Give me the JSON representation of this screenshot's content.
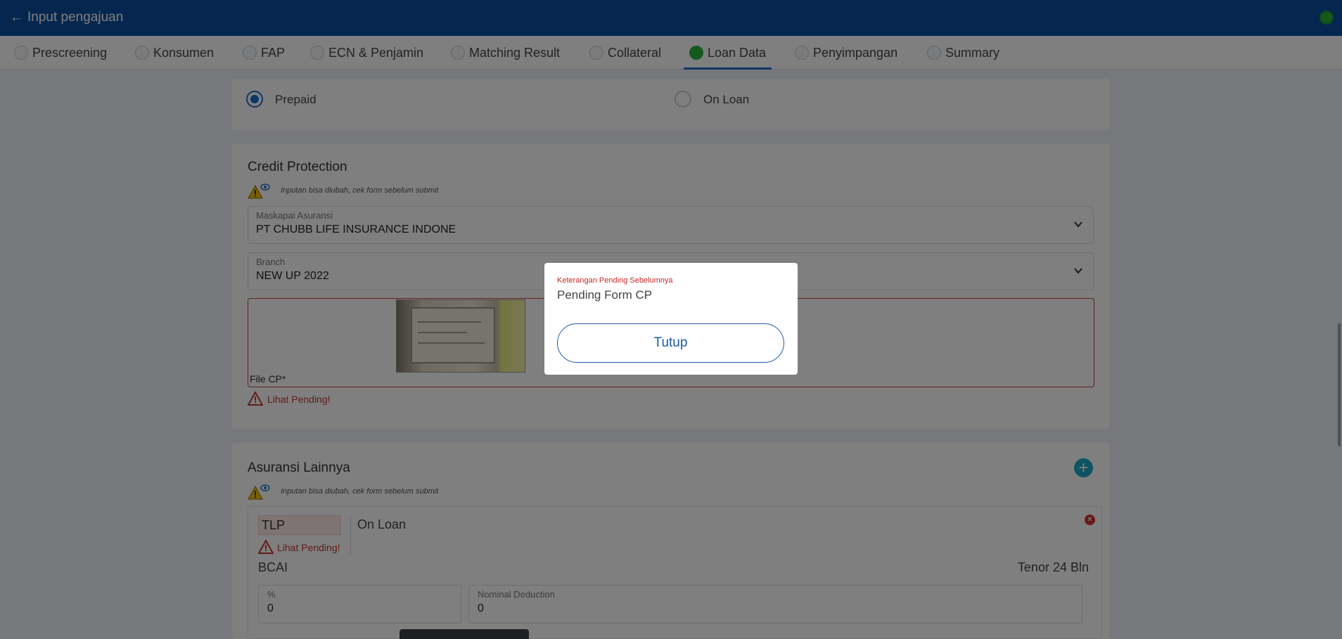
{
  "header": {
    "back_icon": "arrow-left-icon",
    "title": "Input pengajuan",
    "status_color": "#27b33c"
  },
  "tabs": [
    {
      "label": "Prescreening",
      "active": false
    },
    {
      "label": "Konsumen",
      "active": false
    },
    {
      "label": "FAP",
      "active": false
    },
    {
      "label": "ECN & Penjamin",
      "active": false
    },
    {
      "label": "Matching Result",
      "active": false
    },
    {
      "label": "Collateral",
      "active": false
    },
    {
      "label": "Loan Data",
      "active": true
    },
    {
      "label": "Penyimpangan",
      "active": false
    },
    {
      "label": "Summary",
      "active": false
    }
  ],
  "payment": {
    "option_prepaid": "Prepaid",
    "option_on_loan": "On Loan",
    "selected": "Prepaid"
  },
  "credit_protection": {
    "title": "Credit Protection",
    "note": "Inputan bisa diubah, cek form sebelum submit",
    "insurer_label": "Maskapai Asuransi",
    "insurer_value": "PT CHUBB LIFE INSURANCE INDONE",
    "branch_label": "Branch",
    "branch_value": "NEW UP 2022",
    "file_label": "File CP*",
    "pending_link": "Lihat Pending!"
  },
  "other_insurance": {
    "title": "Asuransi Lainnya",
    "note": "Inputan bisa diubah, cek form sebelum submit",
    "item": {
      "code": "TLP",
      "type": "On Loan",
      "pending_link": "Lihat Pending!",
      "provider": "BCAI",
      "tenor": "Tenor 24 Bln",
      "percent_label": "%",
      "percent_value": "0",
      "nominal_label": "Nominal Deduction",
      "nominal_value": "0"
    }
  },
  "modal": {
    "title": "Keterangan Pending Sebelumnya",
    "message": "Pending Form CP",
    "close_label": "Tutup"
  },
  "colors": {
    "primary": "#0a4d9c",
    "accent": "#1a6fd1",
    "danger": "#c62828",
    "success": "#27b33c"
  }
}
